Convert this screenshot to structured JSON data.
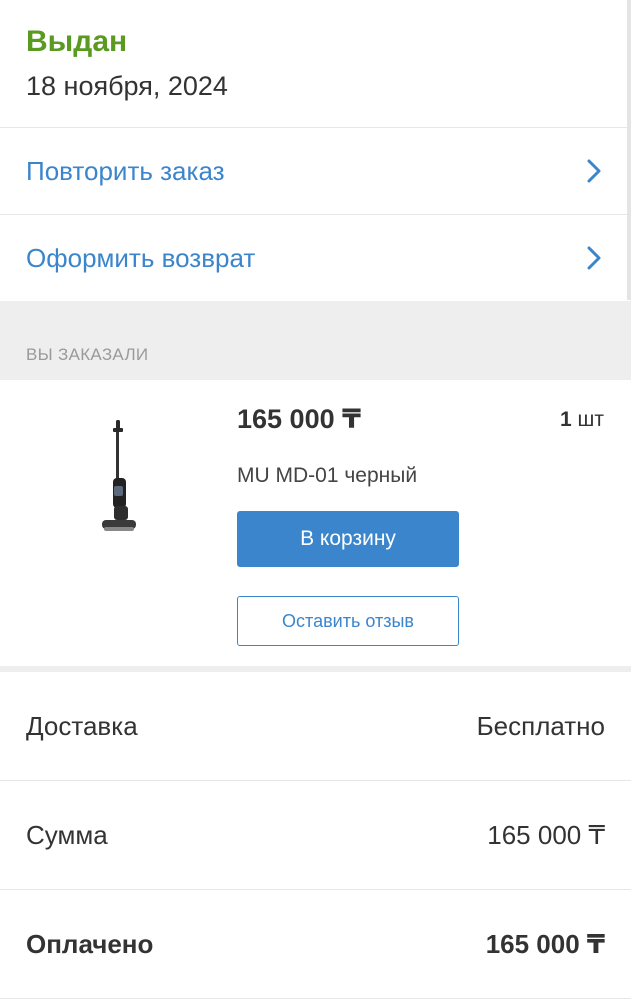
{
  "order": {
    "status": "Выдан",
    "date": "18 ноября, 2024"
  },
  "actions": [
    {
      "label": "Повторить заказ",
      "icon": "chevron-right-icon"
    },
    {
      "label": "Оформить возврат",
      "icon": "chevron-right-icon"
    }
  ],
  "section": {
    "label": "ВЫ ЗАКАЗАЛИ"
  },
  "product": {
    "price": "165 000 ₸",
    "qty_number": "1",
    "qty_unit": "шт",
    "name": "MU MD-01 черный",
    "cart_button": "В корзину",
    "review_button": "Оставить отзыв"
  },
  "summary": {
    "delivery_label": "Доставка",
    "delivery_value": "Бесплатно",
    "sum_label": "Сумма",
    "sum_value": "165 000 ₸",
    "paid_label": "Оплачено",
    "paid_value": "165 000 ₸"
  },
  "colors": {
    "status_green": "#5a9a21",
    "accent_blue": "#3b85cc",
    "section_gray": "#eeeeee"
  }
}
